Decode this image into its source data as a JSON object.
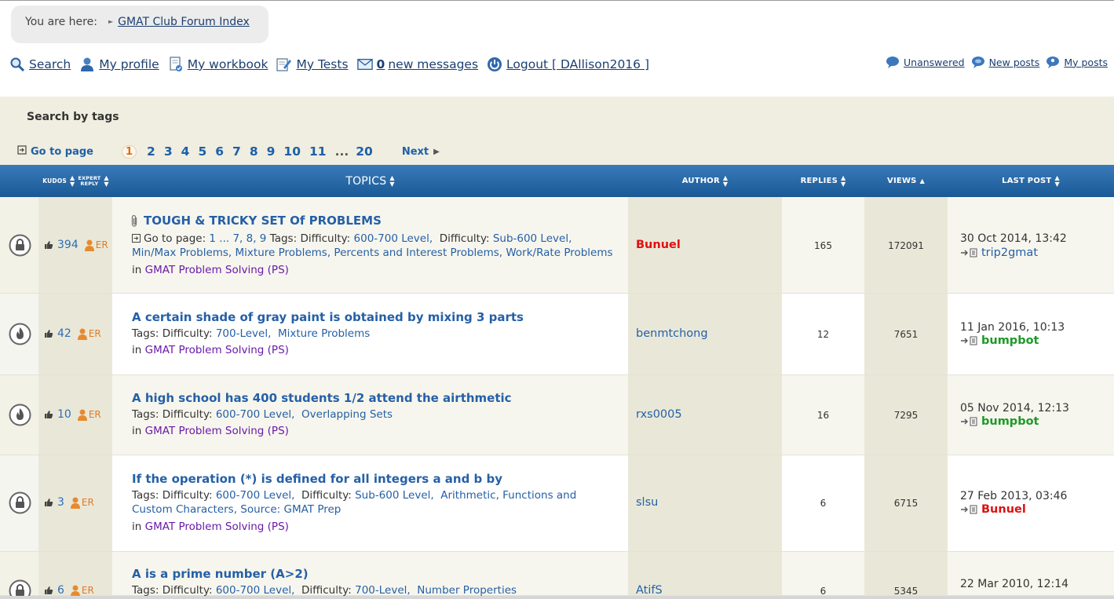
{
  "breadcrumb": {
    "prefix": "You are here:",
    "link": "GMAT Club Forum Index"
  },
  "nav": {
    "search": "Search",
    "profile": "My profile",
    "workbook": "My workbook",
    "tests": "My Tests",
    "messages_count": "0",
    "messages_label": "new messages",
    "logout": "Logout [ DAllison2016 ]",
    "unanswered": "Unanswered",
    "new_posts": "New posts",
    "my_posts": "My posts"
  },
  "tags": {
    "title": "Search by tags"
  },
  "pager": {
    "goto": "Go to page",
    "current": "1",
    "pages": [
      "2",
      "3",
      "4",
      "5",
      "6",
      "7",
      "8",
      "9",
      "10",
      "11"
    ],
    "dots": "...",
    "last": "20",
    "next": "Next"
  },
  "table_header": {
    "kudos": "KUDOS",
    "expert_reply": [
      "EXPERT",
      "REPLY"
    ],
    "topics": "TOPICS",
    "author": "AUTHOR",
    "replies": "REPLIES",
    "views": "VIEWS",
    "last_post": "LAST POST"
  },
  "rows": [
    {
      "title": "TOUGH & TRICKY SET Of PROBLEMS",
      "goto_label": "Go to page:",
      "goto_pages": "1 ... 7, 8, 9",
      "tags_line1": "Tags: ",
      "tags_a": "Difficulty:",
      "tags_a_val": "600-700 Level,",
      "tags_b": "Difficulty:",
      "tags_b_val": "Sub-600 Level,",
      "tags_rest": "Min/Max Problems,  Mixture Problems,  Percents and Interest Problems,  Work/Rate Problems",
      "in_prefix": "in",
      "forum": "GMAT Problem Solving (PS)",
      "kudos": "394",
      "er": "ER",
      "author": "Bunuel",
      "replies": "165",
      "views": "172091",
      "last_date": "30 Oct 2014, 13:42",
      "last_by": "trip2gmat"
    },
    {
      "title": "A certain shade of gray paint is obtained by mixing 3 parts",
      "tags_line1": "Tags: ",
      "tags_a": "Difficulty:",
      "tags_a_val": "700-Level,",
      "tags_rest": "Mixture Problems",
      "in_prefix": "in",
      "forum": "GMAT Problem Solving (PS)",
      "kudos": "42",
      "er": "ER",
      "author": "benmtchong",
      "replies": "12",
      "views": "7651",
      "last_date": "11 Jan 2016, 10:13",
      "last_by": "bumpbot"
    },
    {
      "title": "A high school has 400 students 1/2 attend the airthmetic",
      "tags_line1": "Tags: ",
      "tags_a": "Difficulty:",
      "tags_a_val": "600-700 Level,",
      "tags_rest": "Overlapping Sets",
      "in_prefix": "in",
      "forum": "GMAT Problem Solving (PS)",
      "kudos": "10",
      "er": "ER",
      "author": "rxs0005",
      "replies": "16",
      "views": "7295",
      "last_date": "05 Nov 2014, 12:13",
      "last_by": "bumpbot"
    },
    {
      "title": "If the operation (*) is defined for all integers a and b by",
      "tags_line1": "Tags: ",
      "tags_a": "Difficulty:",
      "tags_a_val": "600-700 Level,",
      "tags_b": "Difficulty:",
      "tags_b_val": "Sub-600 Level,",
      "tags_rest": "Arithmetic,  Functions and Custom Characters,  Source: GMAT Prep",
      "in_prefix": "in",
      "forum": "GMAT Problem Solving (PS)",
      "kudos": "3",
      "er": "ER",
      "author": "slsu",
      "replies": "6",
      "views": "6715",
      "last_date": "27 Feb 2013, 03:46",
      "last_by": "Bunuel"
    },
    {
      "title": "A is a prime number (A>2)",
      "tags_line1": "Tags: ",
      "tags_a": "Difficulty:",
      "tags_a_val": "600-700 Level,",
      "tags_b": "Difficulty:",
      "tags_b_val": "700-Level,",
      "tags_rest": "Number Properties",
      "kudos": "6",
      "er": "ER",
      "author": "AtifS",
      "replies": "6",
      "views": "5345",
      "last_date": "22 Mar 2010, 12:14"
    }
  ]
}
